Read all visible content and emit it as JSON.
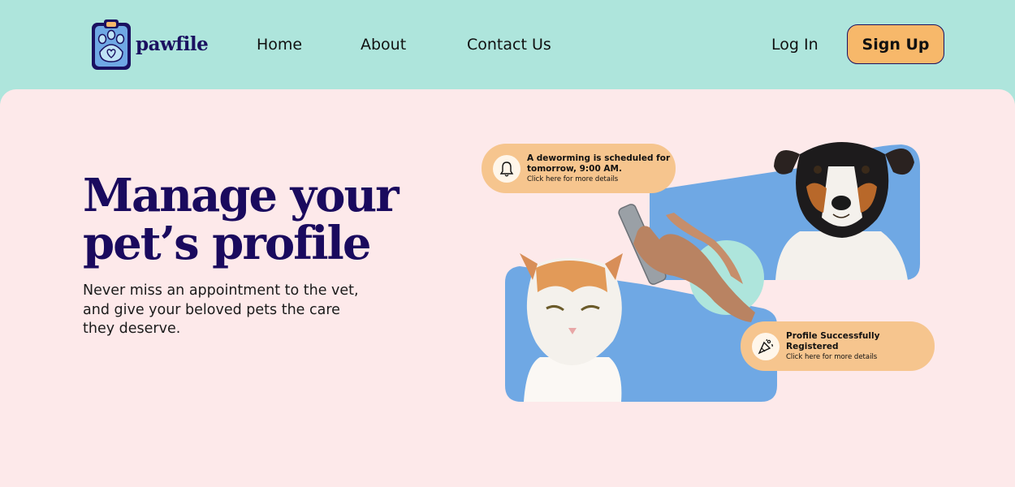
{
  "brand": {
    "name": "pawfile"
  },
  "nav": {
    "home": "Home",
    "about": "About",
    "contact": "Contact Us",
    "login": "Log In",
    "signup": "Sign Up"
  },
  "hero": {
    "title_line1": "Manage your",
    "title_line2": "pet’s profile",
    "subtitle": "Never miss an appointment to the vet, and give your beloved pets the care they deserve."
  },
  "notifications": [
    {
      "title": "A deworming is scheduled for tomorrow, 9:00 AM.",
      "detail": "Click here for more details",
      "icon": "bell-icon"
    },
    {
      "title": "Profile Successfully Registered",
      "detail": "Click here for more details",
      "icon": "party-popper-icon"
    }
  ],
  "colors": {
    "header_bg": "#aee5dc",
    "panel_bg": "#fde9ea",
    "accent": "#f7b86a",
    "brand_navy": "#1a0a5e",
    "photo_blue": "#6fa8e4",
    "notif_bg": "#f6c58e"
  }
}
